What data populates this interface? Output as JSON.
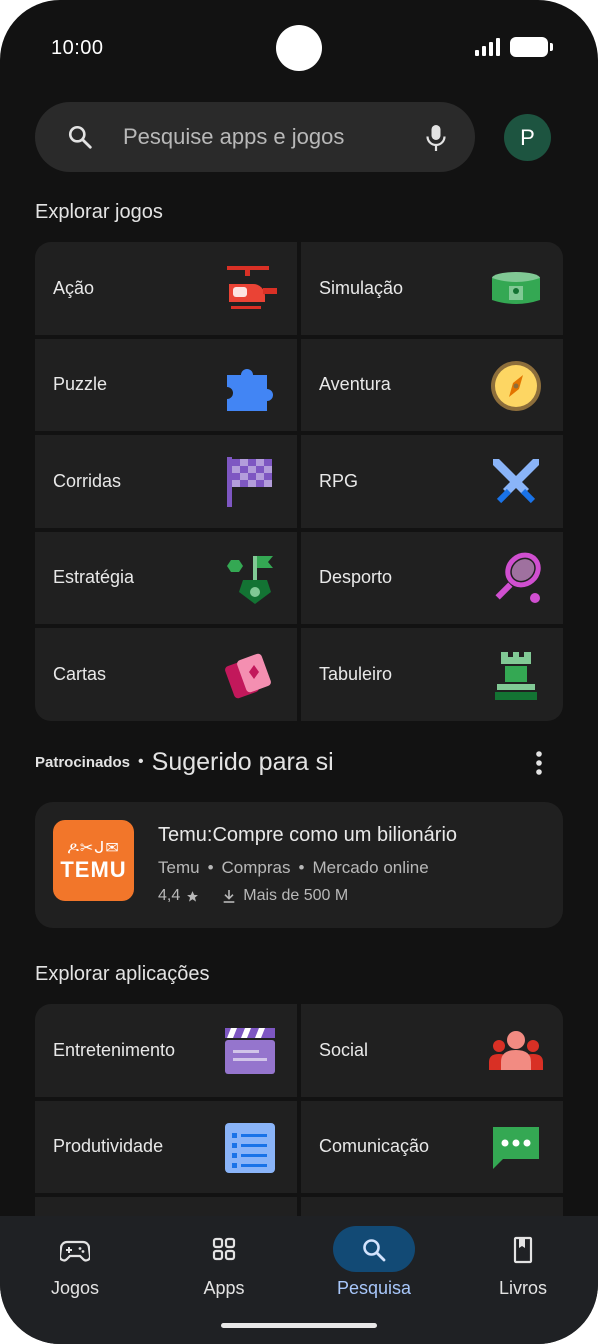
{
  "status": {
    "time": "10:00"
  },
  "search": {
    "placeholder": "Pesquise apps e jogos",
    "avatar_letter": "P"
  },
  "games": {
    "title": "Explorar jogos",
    "categories": [
      {
        "label": "Ação",
        "icon": "helicopter-icon"
      },
      {
        "label": "Simulação",
        "icon": "stadium-icon"
      },
      {
        "label": "Puzzle",
        "icon": "puzzle-piece-icon"
      },
      {
        "label": "Aventura",
        "icon": "compass-icon"
      },
      {
        "label": "Corridas",
        "icon": "checkered-flag-icon"
      },
      {
        "label": "RPG",
        "icon": "crossed-swords-icon"
      },
      {
        "label": "Estratégia",
        "icon": "strategy-flag-icon"
      },
      {
        "label": "Desporto",
        "icon": "tennis-racket-icon"
      },
      {
        "label": "Cartas",
        "icon": "playing-cards-icon"
      },
      {
        "label": "Tabuleiro",
        "icon": "chess-rook-icon"
      }
    ]
  },
  "sponsored": {
    "tag": "Patrocinados",
    "separator": "•",
    "title": "Sugerido para si",
    "app": {
      "name": "Temu:Compre como um bilionário",
      "logo_text": "TEMU",
      "developer": "Temu",
      "category": "Compras",
      "subcategory": "Mercado online",
      "rating": "4,4",
      "downloads": "Mais de 500 M"
    }
  },
  "apps": {
    "title": "Explorar aplicações",
    "categories": [
      {
        "label": "Entretenimento",
        "icon": "clapperboard-icon"
      },
      {
        "label": "Social",
        "icon": "people-icon"
      },
      {
        "label": "Produtividade",
        "icon": "checklist-icon"
      },
      {
        "label": "Comunicação",
        "icon": "chat-bubble-icon"
      }
    ]
  },
  "nav": {
    "items": [
      {
        "label": "Jogos",
        "icon": "gamepad-icon"
      },
      {
        "label": "Apps",
        "icon": "apps-grid-icon"
      },
      {
        "label": "Pesquisa",
        "icon": "search-icon",
        "active": true
      },
      {
        "label": "Livros",
        "icon": "book-icon"
      }
    ]
  },
  "colors": {
    "background": "#121212",
    "surface": "#202020",
    "accent": "#a8c7fa",
    "active_pill": "#124a75",
    "temu": "#f2762a"
  }
}
